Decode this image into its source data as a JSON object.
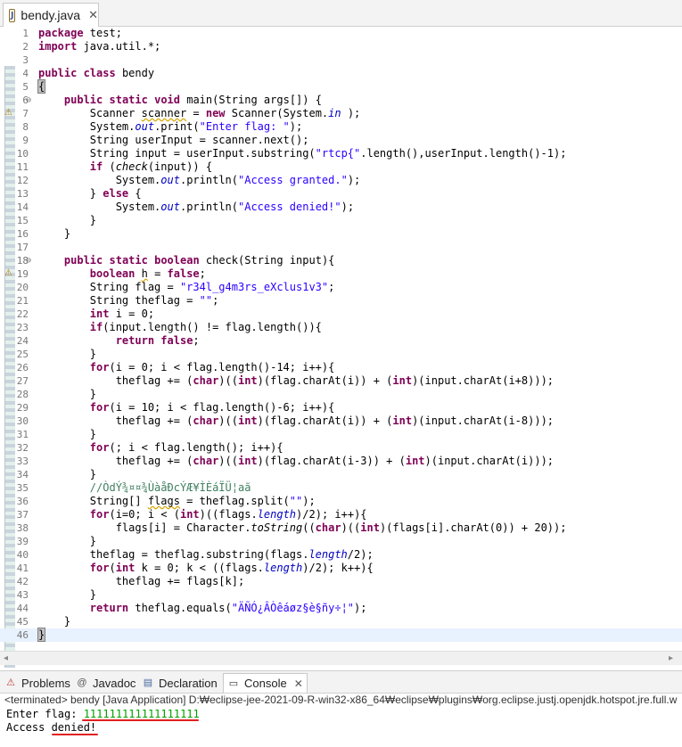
{
  "editor_tab": {
    "file_name": "bendy.java",
    "icon": "java-file-icon"
  },
  "code": [
    {
      "n": "1",
      "s": [
        [
          "kw",
          "package"
        ],
        [
          "",
          " test;"
        ]
      ]
    },
    {
      "n": "2",
      "s": [
        [
          "kw",
          "import"
        ],
        [
          "",
          " java.util.*;"
        ]
      ]
    },
    {
      "n": "3",
      "s": []
    },
    {
      "n": "4",
      "s": [
        [
          "kw",
          "public"
        ],
        [
          "",
          " "
        ],
        [
          "kw",
          "class"
        ],
        [
          "",
          " bendy"
        ]
      ]
    },
    {
      "n": "5",
      "s": [
        [
          "sel",
          "{"
        ]
      ]
    },
    {
      "n": "6",
      "fold": "⊖",
      "s": [
        [
          "",
          "    "
        ],
        [
          "kw",
          "public"
        ],
        [
          "",
          " "
        ],
        [
          "kw",
          "static"
        ],
        [
          "",
          " "
        ],
        [
          "kw",
          "void"
        ],
        [
          "",
          " main(String args[]) {"
        ]
      ]
    },
    {
      "n": "7",
      "warn": true,
      "s": [
        [
          "",
          "        Scanner "
        ],
        [
          "unused",
          "scanner"
        ],
        [
          "",
          " = "
        ],
        [
          "kw",
          "new"
        ],
        [
          "",
          " Scanner(System."
        ],
        [
          "fld",
          "in"
        ],
        [
          "",
          " );"
        ]
      ]
    },
    {
      "n": "8",
      "s": [
        [
          "",
          "        System."
        ],
        [
          "fld",
          "out"
        ],
        [
          "",
          ".print("
        ],
        [
          "str",
          "\"Enter flag: \""
        ],
        [
          "",
          ");"
        ]
      ]
    },
    {
      "n": "9",
      "s": [
        [
          "",
          "        String userInput = scanner.next();"
        ]
      ]
    },
    {
      "n": "10",
      "s": [
        [
          "",
          "        String input = userInput.substring("
        ],
        [
          "str",
          "\"rtcp{\""
        ],
        [
          "",
          ".length(),userInput.length()-1);"
        ]
      ]
    },
    {
      "n": "11",
      "s": [
        [
          "",
          "        "
        ],
        [
          "kw",
          "if"
        ],
        [
          "",
          " ("
        ],
        [
          "mth",
          "check"
        ],
        [
          "",
          "(input)) {"
        ]
      ]
    },
    {
      "n": "12",
      "s": [
        [
          "",
          "            System."
        ],
        [
          "fld",
          "out"
        ],
        [
          "",
          ".println("
        ],
        [
          "str",
          "\"Access granted.\""
        ],
        [
          "",
          ");"
        ]
      ]
    },
    {
      "n": "13",
      "s": [
        [
          "",
          "        } "
        ],
        [
          "kw",
          "else"
        ],
        [
          "",
          " {"
        ]
      ]
    },
    {
      "n": "14",
      "s": [
        [
          "",
          "            System."
        ],
        [
          "fld",
          "out"
        ],
        [
          "",
          ".println("
        ],
        [
          "str",
          "\"Access denied!\""
        ],
        [
          "",
          ");"
        ]
      ]
    },
    {
      "n": "15",
      "s": [
        [
          "",
          "        }"
        ]
      ]
    },
    {
      "n": "16",
      "s": [
        [
          "",
          "    }"
        ]
      ]
    },
    {
      "n": "17",
      "s": []
    },
    {
      "n": "18",
      "fold": "⊖",
      "s": [
        [
          "",
          "    "
        ],
        [
          "kw",
          "public"
        ],
        [
          "",
          " "
        ],
        [
          "kw",
          "static"
        ],
        [
          "",
          " "
        ],
        [
          "kw",
          "boolean"
        ],
        [
          "",
          " check(String input){"
        ]
      ]
    },
    {
      "n": "19",
      "warn": true,
      "s": [
        [
          "",
          "        "
        ],
        [
          "kw",
          "boolean"
        ],
        [
          "",
          " "
        ],
        [
          "unused",
          "h"
        ],
        [
          "",
          " = "
        ],
        [
          "kw",
          "false"
        ],
        [
          "",
          ";"
        ]
      ]
    },
    {
      "n": "20",
      "s": [
        [
          "",
          "        String flag = "
        ],
        [
          "str",
          "\"r34l_g4m3rs_eXclus1v3\""
        ],
        [
          "",
          ";"
        ]
      ]
    },
    {
      "n": "21",
      "s": [
        [
          "",
          "        String theflag = "
        ],
        [
          "str",
          "\"\""
        ],
        [
          "",
          ";"
        ]
      ]
    },
    {
      "n": "22",
      "s": [
        [
          "",
          "        "
        ],
        [
          "kw",
          "int"
        ],
        [
          "",
          " i = 0;"
        ]
      ]
    },
    {
      "n": "23",
      "s": [
        [
          "",
          "        "
        ],
        [
          "kw",
          "if"
        ],
        [
          "",
          "(input.length() != flag.length()){"
        ]
      ]
    },
    {
      "n": "24",
      "s": [
        [
          "",
          "            "
        ],
        [
          "kw",
          "return"
        ],
        [
          "",
          " "
        ],
        [
          "kw",
          "false"
        ],
        [
          "",
          ";"
        ]
      ]
    },
    {
      "n": "25",
      "s": [
        [
          "",
          "        }"
        ]
      ]
    },
    {
      "n": "26",
      "s": [
        [
          "",
          "        "
        ],
        [
          "kw",
          "for"
        ],
        [
          "",
          "(i = 0; i < flag.length()-14; i++){"
        ]
      ]
    },
    {
      "n": "27",
      "s": [
        [
          "",
          "            theflag += ("
        ],
        [
          "kw",
          "char"
        ],
        [
          "",
          ")(("
        ],
        [
          "kw",
          "int"
        ],
        [
          "",
          ")(flag.charAt(i)) + ("
        ],
        [
          "kw",
          "int"
        ],
        [
          "",
          ")(input.charAt(i+8)));"
        ]
      ]
    },
    {
      "n": "28",
      "s": [
        [
          "",
          "        }"
        ]
      ]
    },
    {
      "n": "29",
      "s": [
        [
          "",
          "        "
        ],
        [
          "kw",
          "for"
        ],
        [
          "",
          "(i = 10; i < flag.length()-6; i++){"
        ]
      ]
    },
    {
      "n": "30",
      "s": [
        [
          "",
          "            theflag += ("
        ],
        [
          "kw",
          "char"
        ],
        [
          "",
          ")(("
        ],
        [
          "kw",
          "int"
        ],
        [
          "",
          ")(flag.charAt(i)) + ("
        ],
        [
          "kw",
          "int"
        ],
        [
          "",
          ")(input.charAt(i-8)));"
        ]
      ]
    },
    {
      "n": "31",
      "s": [
        [
          "",
          "        }"
        ]
      ]
    },
    {
      "n": "32",
      "s": [
        [
          "",
          "        "
        ],
        [
          "kw",
          "for"
        ],
        [
          "",
          "(; i < flag.length(); i++){"
        ]
      ]
    },
    {
      "n": "33",
      "s": [
        [
          "",
          "            theflag += ("
        ],
        [
          "kw",
          "char"
        ],
        [
          "",
          ")(("
        ],
        [
          "kw",
          "int"
        ],
        [
          "",
          ")(flag.charAt(i-3)) + ("
        ],
        [
          "kw",
          "int"
        ],
        [
          "",
          ")(input.charAt(i)));"
        ]
      ]
    },
    {
      "n": "34",
      "s": [
        [
          "",
          "        }"
        ]
      ]
    },
    {
      "n": "35",
      "s": [
        [
          "",
          "        "
        ],
        [
          "cmt",
          "//ÒdÝ¾¤¤¾ÙàåÐcÝÆ¥ÌÈáÏÜ¦aã"
        ]
      ]
    },
    {
      "n": "36",
      "s": [
        [
          "",
          "        String[] "
        ],
        [
          "unused",
          "flags"
        ],
        [
          "",
          " = theflag.split("
        ],
        [
          "str",
          "\"\""
        ],
        [
          "",
          ");"
        ]
      ]
    },
    {
      "n": "37",
      "s": [
        [
          "",
          "        "
        ],
        [
          "kw",
          "for"
        ],
        [
          "",
          "(i=0; i < ("
        ],
        [
          "kw",
          "int"
        ],
        [
          "",
          ")((flags."
        ],
        [
          "fld",
          "length"
        ],
        [
          "",
          ")/2); i++){"
        ]
      ]
    },
    {
      "n": "38",
      "s": [
        [
          "",
          "            flags[i] = Character."
        ],
        [
          "mth",
          "toString"
        ],
        [
          "",
          "(("
        ],
        [
          "kw",
          "char"
        ],
        [
          "",
          ")(("
        ],
        [
          "kw",
          "int"
        ],
        [
          "",
          ")(flags[i].charAt(0)) + 20));"
        ]
      ]
    },
    {
      "n": "39",
      "s": [
        [
          "",
          "        }"
        ]
      ]
    },
    {
      "n": "40",
      "s": [
        [
          "",
          "        theflag = theflag.substring(flags."
        ],
        [
          "fld",
          "length"
        ],
        [
          "",
          "/2);"
        ]
      ]
    },
    {
      "n": "41",
      "s": [
        [
          "",
          "        "
        ],
        [
          "kw",
          "for"
        ],
        [
          "",
          "("
        ],
        [
          "kw",
          "int"
        ],
        [
          "",
          " k = 0; k < ((flags."
        ],
        [
          "fld",
          "length"
        ],
        [
          "",
          ")/2); k++){"
        ]
      ]
    },
    {
      "n": "42",
      "s": [
        [
          "",
          "            theflag += flags[k];"
        ]
      ]
    },
    {
      "n": "43",
      "s": [
        [
          "",
          "        }"
        ]
      ]
    },
    {
      "n": "44",
      "s": [
        [
          "",
          "        "
        ],
        [
          "kw",
          "return"
        ],
        [
          "",
          " theflag.equals("
        ],
        [
          "str",
          "\"ÄÑÓ¿ÂÒêáøz§è§ñy÷¦\""
        ],
        [
          "",
          ");"
        ]
      ]
    },
    {
      "n": "45",
      "s": [
        [
          "",
          "    }"
        ]
      ]
    },
    {
      "n": "46",
      "current": true,
      "s": [
        [
          "sel",
          "}"
        ]
      ]
    }
  ],
  "panel_tabs": [
    {
      "label": "Problems",
      "icon": "problems-icon",
      "glyph": "⚠",
      "color": "#c04040"
    },
    {
      "label": "Javadoc",
      "icon": "javadoc-icon",
      "glyph": "@",
      "color": "#555555"
    },
    {
      "label": "Declaration",
      "icon": "declaration-icon",
      "glyph": "▤",
      "color": "#4a6aa0"
    },
    {
      "label": "Console",
      "icon": "console-icon",
      "glyph": "▭",
      "color": "#333333",
      "active": true
    }
  ],
  "console": {
    "header": "<terminated> bendy [Java Application] D:₩eclipse-jee-2021-09-R-win32-x86_64₩eclipse₩plugins₩org.eclipse.justj.openjdk.hotspot.jre.full.w",
    "prompt": "Enter flag: ",
    "input": "111111111111111111",
    "output": "Access denied!"
  }
}
